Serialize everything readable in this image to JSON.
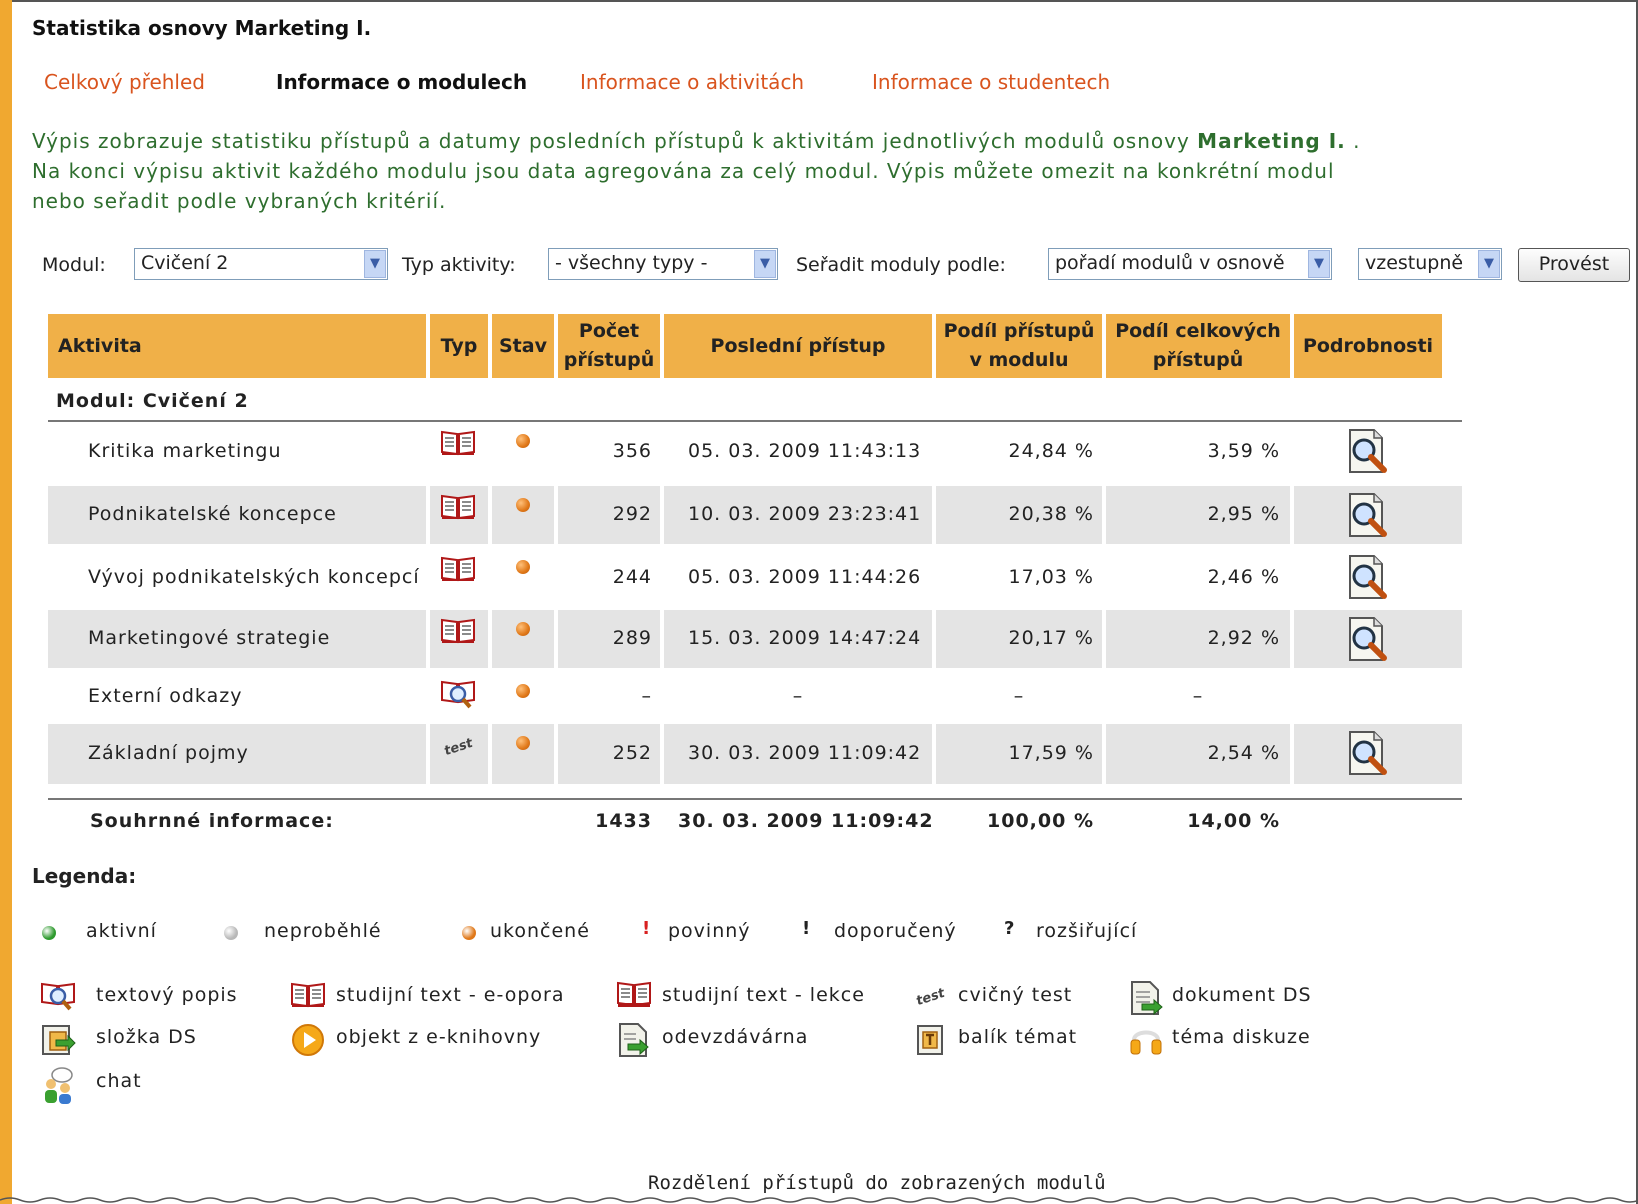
{
  "page_title": "Statistika osnovy Marketing I.",
  "tabs": [
    {
      "label": "Celkový přehled",
      "active": false
    },
    {
      "label": "Informace o modulech",
      "active": true
    },
    {
      "label": "Informace o aktivitách",
      "active": false
    },
    {
      "label": "Informace o studentech",
      "active": false
    }
  ],
  "description": {
    "line1_prefix": "Výpis zobrazuje statistiku přístupů a datumy posledních přístupů k aktivitám jednotlivých modulů osnovy ",
    "course_name": "Marketing I.",
    "line1_suffix": " .",
    "line2": "Na konci výpisu aktivit každého modulu jsou data agregována za celý modul. Výpis můžete omezit na konkrétní modul",
    "line3": "nebo seřadit podle vybraných kritérií."
  },
  "filters": {
    "module_label": "Modul:",
    "module_value": "Cvičení 2",
    "activity_type_label": "Typ aktivity:",
    "activity_type_value": "- všechny typy -",
    "sort_label": "Seřadit moduly podle:",
    "sort_value": "pořadí modulů v osnově",
    "order_value": "vzestupně",
    "submit_label": "Provést"
  },
  "table": {
    "headers": {
      "activity": "Aktivita",
      "type": "Typ",
      "status": "Stav",
      "count_1": "Počet",
      "count_2": "přístupů",
      "last_access": "Poslední přístup",
      "share_module_1": "Podíl přístupů",
      "share_module_2": "v modulu",
      "share_total_1": "Podíl celkových",
      "share_total_2": "přístupů",
      "details": "Podrobnosti"
    },
    "module_caption": "Modul: Cvičení 2",
    "rows": [
      {
        "name": "Kritika marketingu",
        "type_icon": "book-icon",
        "count": "356",
        "last": "05. 03. 2009 11:43:13",
        "share_module": "24,84 %",
        "share_total": "3,59 %",
        "has_details": true
      },
      {
        "name": "Podnikatelské koncepce",
        "type_icon": "book-icon",
        "count": "292",
        "last": "10. 03. 2009 23:23:41",
        "share_module": "20,38 %",
        "share_total": "2,95 %",
        "has_details": true
      },
      {
        "name": "Vývoj podnikatelských koncepcí",
        "type_icon": "book-icon",
        "count": "244",
        "last": "05. 03. 2009 11:44:26",
        "share_module": "17,03 %",
        "share_total": "2,46 %",
        "has_details": true
      },
      {
        "name": "Marketingové strategie",
        "type_icon": "book-icon",
        "count": "289",
        "last": "15. 03. 2009 14:47:24",
        "share_module": "20,17 %",
        "share_total": "2,92 %",
        "has_details": true
      },
      {
        "name": "Externí odkazy",
        "type_icon": "text-description-icon",
        "count": "–",
        "last": "–",
        "share_module": "–",
        "share_total": "–",
        "has_details": false
      },
      {
        "name": "Základní pojmy",
        "type_icon": "test-icon",
        "count": "252",
        "last": "30. 03. 2009 11:09:42",
        "share_module": "17,59 %",
        "share_total": "2,54 %",
        "has_details": true
      }
    ],
    "summary": {
      "label": "Souhrnné informace:",
      "count": "1433",
      "last": "30. 03. 2009 11:09:42",
      "share_module": "100,00 %",
      "share_total": "14,00 %"
    }
  },
  "legend": {
    "title": "Legenda:",
    "status": [
      {
        "label": "aktivní",
        "color": "#2e9a2e"
      },
      {
        "label": "neproběhlé",
        "color": "#b8b8b8"
      },
      {
        "label": "ukončené",
        "color": "#e07818"
      },
      {
        "label": "povinný",
        "symbol": "!",
        "color": "#d82020"
      },
      {
        "label": "doporučený",
        "symbol": "!",
        "color": "#222222"
      },
      {
        "label": "rozšiřující",
        "symbol": "?",
        "color": "#222222"
      }
    ],
    "types": [
      {
        "label": "textový popis",
        "icon": "text-description-icon"
      },
      {
        "label": "studijní text - e-opora",
        "icon": "book-icon"
      },
      {
        "label": "studijní text - lekce",
        "icon": "book-lesson-icon"
      },
      {
        "label": "cvičný test",
        "icon": "test-icon"
      },
      {
        "label": "dokument DS",
        "icon": "document-icon"
      },
      {
        "label": "složka DS",
        "icon": "folder-icon"
      },
      {
        "label": "objekt z e-knihovny",
        "icon": "play-icon"
      },
      {
        "label": "odevzdávárna",
        "icon": "submit-icon"
      },
      {
        "label": "balík témat",
        "icon": "topics-package-icon"
      },
      {
        "label": "téma diskuze",
        "icon": "discussion-icon"
      },
      {
        "label": "chat",
        "icon": "chat-icon"
      }
    ]
  },
  "bottom_caption": "Rozdělení přístupů do zobrazených modulů"
}
